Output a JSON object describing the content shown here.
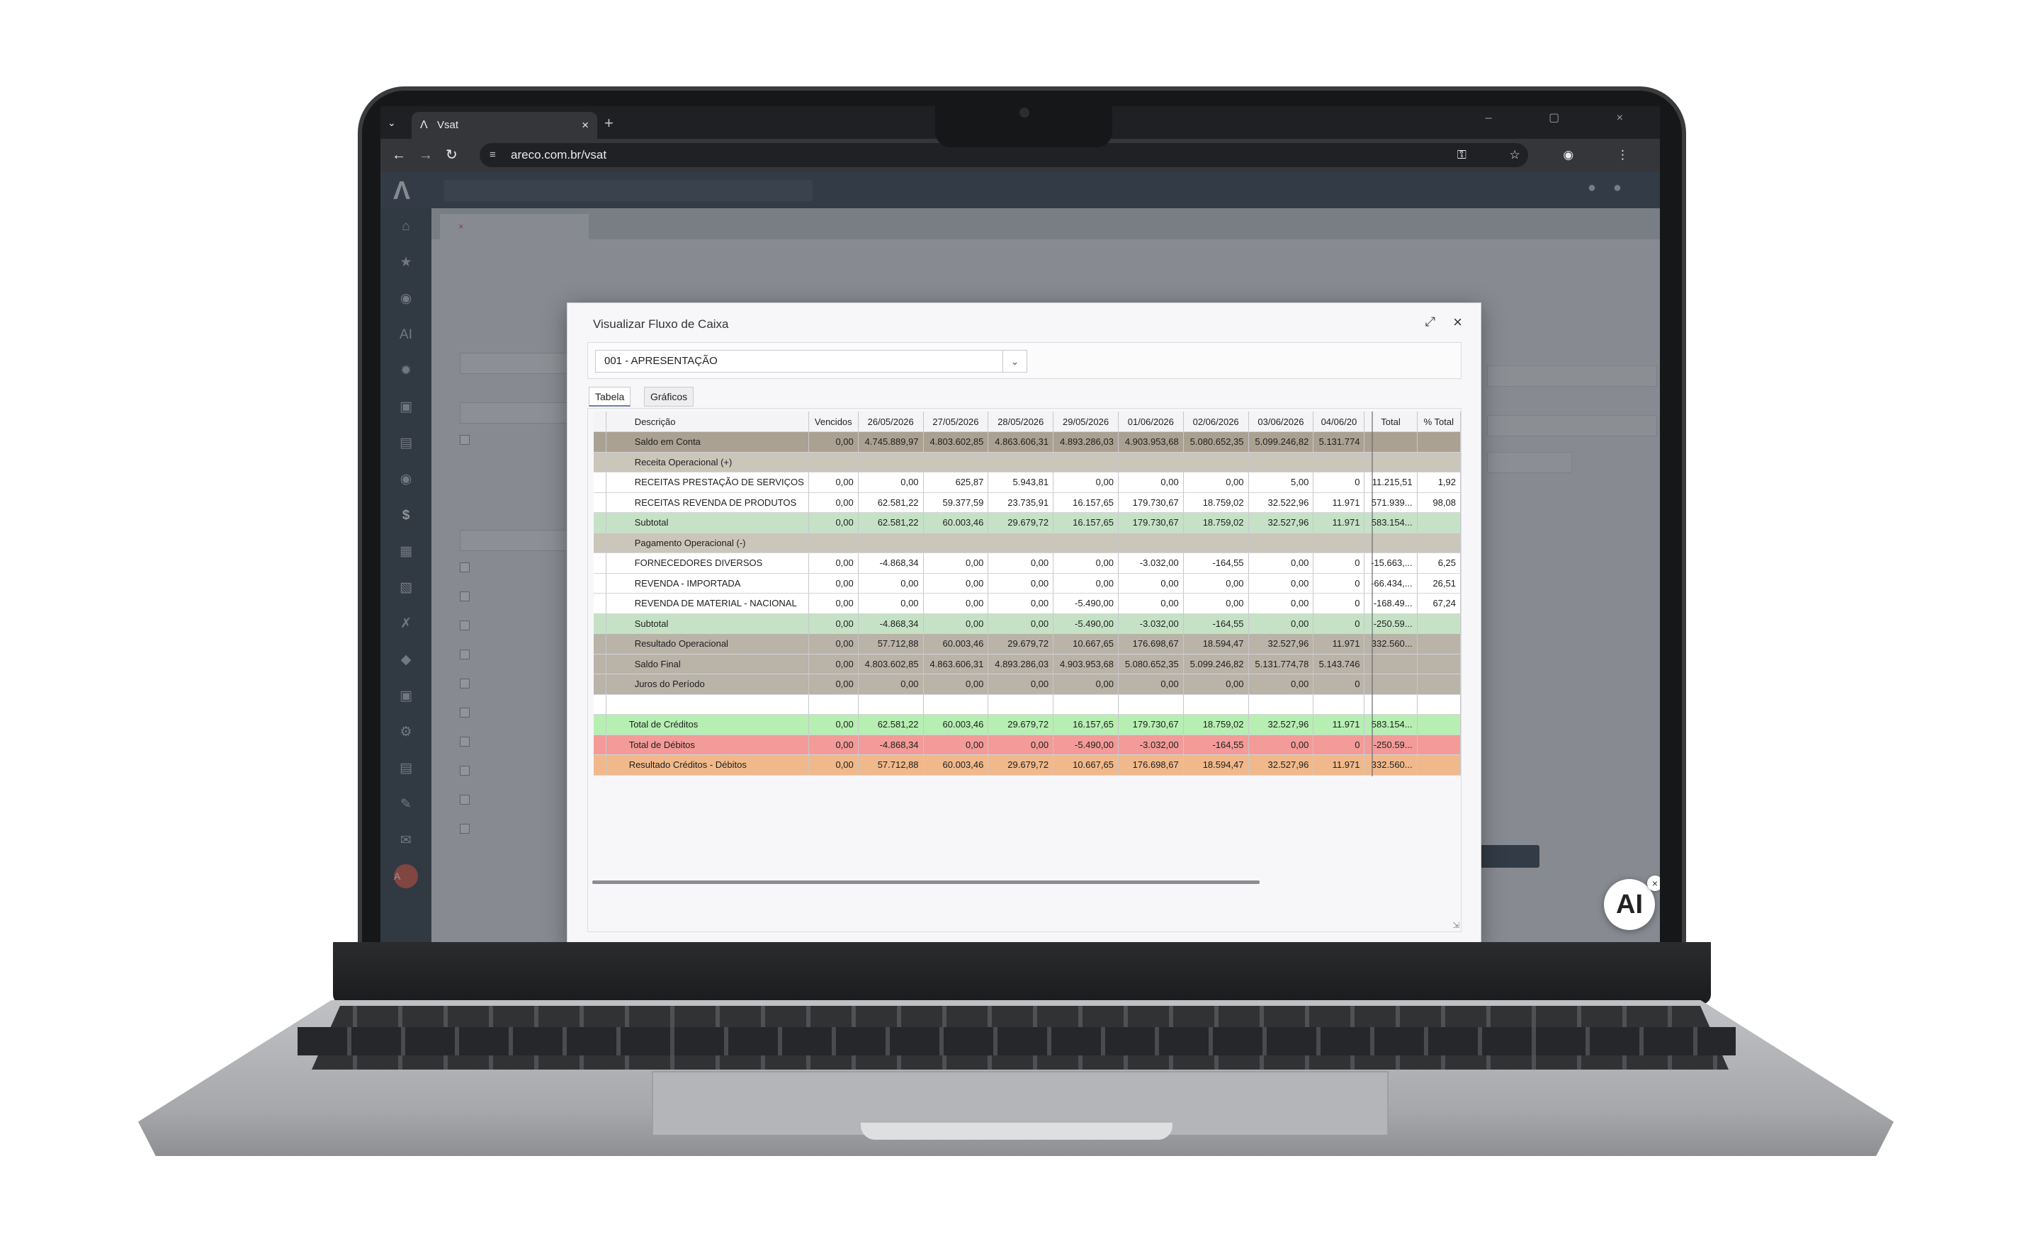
{
  "browser": {
    "tab_title": "Vsat",
    "url": "areco.com.br/vsat",
    "tab_dropdown_icon": "chevron-down-icon",
    "logo_glyph": "Ʌ",
    "close_glyph": "×",
    "newtab_glyph": "+",
    "back_glyph": "←",
    "forward_glyph": "→",
    "reload_glyph": "↻",
    "tune_glyph": "≡",
    "toolbar_glyphs": "⚿ ☆ ◉ ⋮",
    "window_glyphs": "– ▢ ×"
  },
  "app": {
    "search_placeholder": "",
    "tab_label": "",
    "crumb": "",
    "form_labels": [],
    "checkboxes": []
  },
  "modal": {
    "title": "Visualizar Fluxo de Caixa",
    "maximize_glyph": "⤢",
    "close_glyph": "×",
    "select_value": "001 - APRESENTAÇÃO",
    "select_arrow": "⌄",
    "tabs": [
      "Tabela",
      "Gráficos"
    ],
    "active_tab": "Tabela"
  },
  "table": {
    "columns": [
      "Descrição",
      "Vencidos",
      "26/05/2026",
      "27/05/2026",
      "28/05/2026",
      "29/05/2026",
      "01/06/2026",
      "02/06/2026",
      "03/06/2026",
      "04/06/20",
      "Total",
      "% Total"
    ],
    "rows": [
      {
        "type": "saldo",
        "cells": [
          "Saldo em Conta",
          "0,00",
          "4.745.889,97",
          "4.803.602,85",
          "4.863.606,31",
          "4.893.286,03",
          "4.903.953,68",
          "5.080.652,35",
          "5.099.246,82",
          "5.131.774",
          "",
          ""
        ]
      },
      {
        "type": "group",
        "cells": [
          "Receita Operacional (+)",
          "",
          "",
          "",
          "",
          "",
          "",
          "",
          "",
          "",
          "",
          ""
        ]
      },
      {
        "type": "item",
        "cells": [
          "RECEITAS PRESTAÇÃO DE SERVIÇOS",
          "0,00",
          "0,00",
          "625,87",
          "5.943,81",
          "0,00",
          "0,00",
          "0,00",
          "5,00",
          "0",
          "11.215,51",
          "1,92"
        ]
      },
      {
        "type": "item",
        "cells": [
          "RECEITAS REVENDA DE PRODUTOS",
          "0,00",
          "62.581,22",
          "59.377,59",
          "23.735,91",
          "16.157,65",
          "179.730,67",
          "18.759,02",
          "32.522,96",
          "11.971",
          "571.939...",
          "98,08"
        ]
      },
      {
        "type": "sub",
        "cells": [
          "Subtotal",
          "0,00",
          "62.581,22",
          "60.003,46",
          "29.679,72",
          "16.157,65",
          "179.730,67",
          "18.759,02",
          "32.527,96",
          "11.971",
          "583.154...",
          ""
        ]
      },
      {
        "type": "group",
        "cells": [
          "Pagamento Operacional (-)",
          "",
          "",
          "",
          "",
          "",
          "",
          "",
          "",
          "",
          "",
          ""
        ]
      },
      {
        "type": "item",
        "cells": [
          "FORNECEDORES DIVERSOS",
          "0,00",
          "-4.868,34",
          "0,00",
          "0,00",
          "0,00",
          "-3.032,00",
          "-164,55",
          "0,00",
          "0",
          "-15.663,...",
          "6,25"
        ]
      },
      {
        "type": "item",
        "cells": [
          "REVENDA - IMPORTADA",
          "0,00",
          "0,00",
          "0,00",
          "0,00",
          "0,00",
          "0,00",
          "0,00",
          "0,00",
          "0",
          "-66.434,...",
          "26,51"
        ]
      },
      {
        "type": "item",
        "cells": [
          "REVENDA DE MATERIAL - NACIONAL",
          "0,00",
          "0,00",
          "0,00",
          "0,00",
          "-5.490,00",
          "0,00",
          "0,00",
          "0,00",
          "0",
          "-168.49...",
          "67,24"
        ]
      },
      {
        "type": "sub",
        "cells": [
          "Subtotal",
          "0,00",
          "-4.868,34",
          "0,00",
          "0,00",
          "-5.490,00",
          "-3.032,00",
          "-164,55",
          "0,00",
          "0",
          "-250.59...",
          ""
        ]
      },
      {
        "type": "res",
        "cells": [
          "Resultado Operacional",
          "0,00",
          "57.712,88",
          "60.003,46",
          "29.679,72",
          "10.667,65",
          "176.698,67",
          "18.594,47",
          "32.527,96",
          "11.971",
          "332.560...",
          ""
        ]
      },
      {
        "type": "res",
        "cells": [
          "Saldo Final",
          "0,00",
          "4.803.602,85",
          "4.863.606,31",
          "4.893.286,03",
          "4.903.953,68",
          "5.080.652,35",
          "5.099.246,82",
          "5.131.774,78",
          "5.143.746",
          "",
          ""
        ]
      },
      {
        "type": "res",
        "cells": [
          "Juros do Período",
          "0,00",
          "0,00",
          "0,00",
          "0,00",
          "0,00",
          "0,00",
          "0,00",
          "0,00",
          "0",
          "",
          ""
        ]
      },
      {
        "type": "blank",
        "cells": [
          "",
          "",
          "",
          "",
          "",
          "",
          "",
          "",
          "",
          "",
          "",
          ""
        ]
      },
      {
        "type": "cred",
        "cells": [
          "Total de Créditos",
          "0,00",
          "62.581,22",
          "60.003,46",
          "29.679,72",
          "16.157,65",
          "179.730,67",
          "18.759,02",
          "32.527,96",
          "11.971",
          "583.154...",
          ""
        ]
      },
      {
        "type": "deb",
        "cells": [
          "Total de Débitos",
          "0,00",
          "-4.868,34",
          "0,00",
          "0,00",
          "-5.490,00",
          "-3.032,00",
          "-164,55",
          "0,00",
          "0",
          "-250.59...",
          ""
        ]
      },
      {
        "type": "resf",
        "cells": [
          "Resultado Créditos - Débitos",
          "0,00",
          "57.712,88",
          "60.003,46",
          "29.679,72",
          "10.667,65",
          "176.698,67",
          "18.594,47",
          "32.527,96",
          "11.971",
          "332.560...",
          ""
        ]
      }
    ]
  },
  "ai_badge": {
    "label": "AI",
    "close_glyph": "×"
  },
  "colors": {
    "saldo": "#aba192",
    "group": "#cbc6ba",
    "subtotal": "#c6e2c6",
    "resultado": "#b9b3a8",
    "creditos": "#b7efb3",
    "debitos": "#f39b98",
    "resultado_final": "#f1b98b"
  }
}
